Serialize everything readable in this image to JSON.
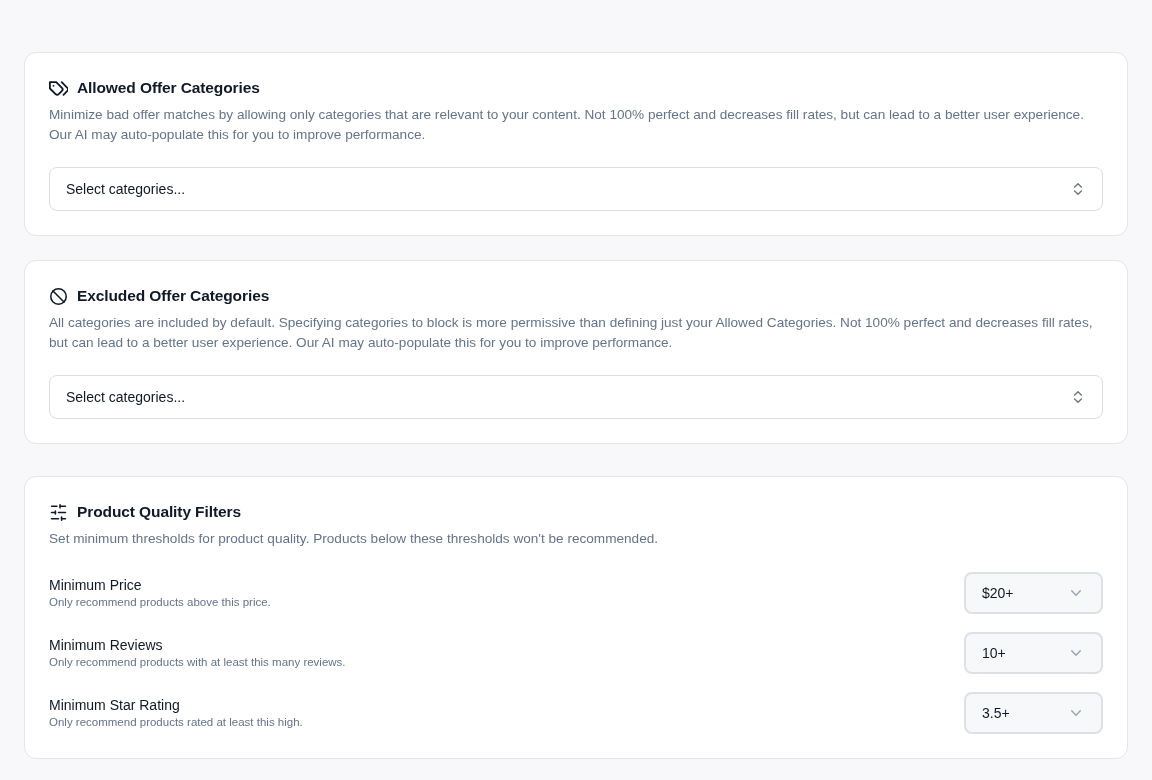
{
  "sections": [
    {
      "kind": "include",
      "title": "Allowed Offer Categories",
      "description": "Minimize bad offer matches by allowing only categories that are relevant to your content. Not 100% perfect and decreases fill rates, but can lead to a better user experience. Our AI may auto-populate this for you to improve performance.",
      "select": {
        "placeholder": "Select categories..."
      }
    },
    {
      "kind": "exclude",
      "title": "Excluded Offer Categories",
      "description": "All categories are included by default. Specifying categories to block is more permissive than defining just your Allowed Categories. Not 100% perfect and decreases fill rates, but can lead to a better user experience. Our AI may auto-populate this for you to improve performance.",
      "select": {
        "placeholder": "Select categories..."
      }
    },
    {
      "kind": "thresholds",
      "title": "Product Quality Filters",
      "description": "Set minimum thresholds for product quality. Products below these thresholds won't be recommended.",
      "filters": [
        {
          "label": "Minimum Price",
          "description": "Only recommend products above this price.",
          "value": "$20+"
        },
        {
          "label": "Minimum Reviews",
          "description": "Only recommend products with at least this many reviews.",
          "value": "10+"
        },
        {
          "label": "Minimum Star Rating",
          "description": "Only recommend products rated at least this high.",
          "value": "3.5+"
        }
      ]
    }
  ]
}
